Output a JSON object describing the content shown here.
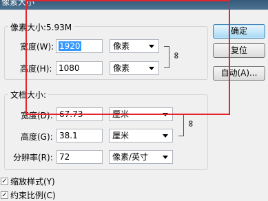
{
  "window": {
    "title": "像素大小"
  },
  "pixel_group": {
    "legend": "像素大小:5.93M",
    "width": {
      "label": "宽度(W):",
      "value": "1920",
      "unit": "像素"
    },
    "height": {
      "label": "高度(H):",
      "value": "1080",
      "unit": "像素"
    }
  },
  "doc_group": {
    "legend": "文档大小:",
    "width": {
      "label": "宽度(D):",
      "value": "67.73",
      "unit": "厘米"
    },
    "height": {
      "label": "高度(G):",
      "value": "38.1",
      "unit": "厘米"
    },
    "resolution": {
      "label": "分辨率(R):",
      "value": "72",
      "unit": "像素/英寸"
    }
  },
  "buttons": {
    "ok": "确定",
    "reset": "复位",
    "auto": "自动(A)..."
  },
  "options": {
    "scale_styles": {
      "label": "缩放样式(Y)",
      "checked": true,
      "check_glyph": "✓"
    },
    "constrain": {
      "label": "约束比例(C)",
      "checked": true,
      "check_glyph": "✓"
    }
  },
  "icons": {
    "link": "∞"
  },
  "colors": {
    "highlight_box": "#e3262e",
    "selection": "#3399ff"
  }
}
